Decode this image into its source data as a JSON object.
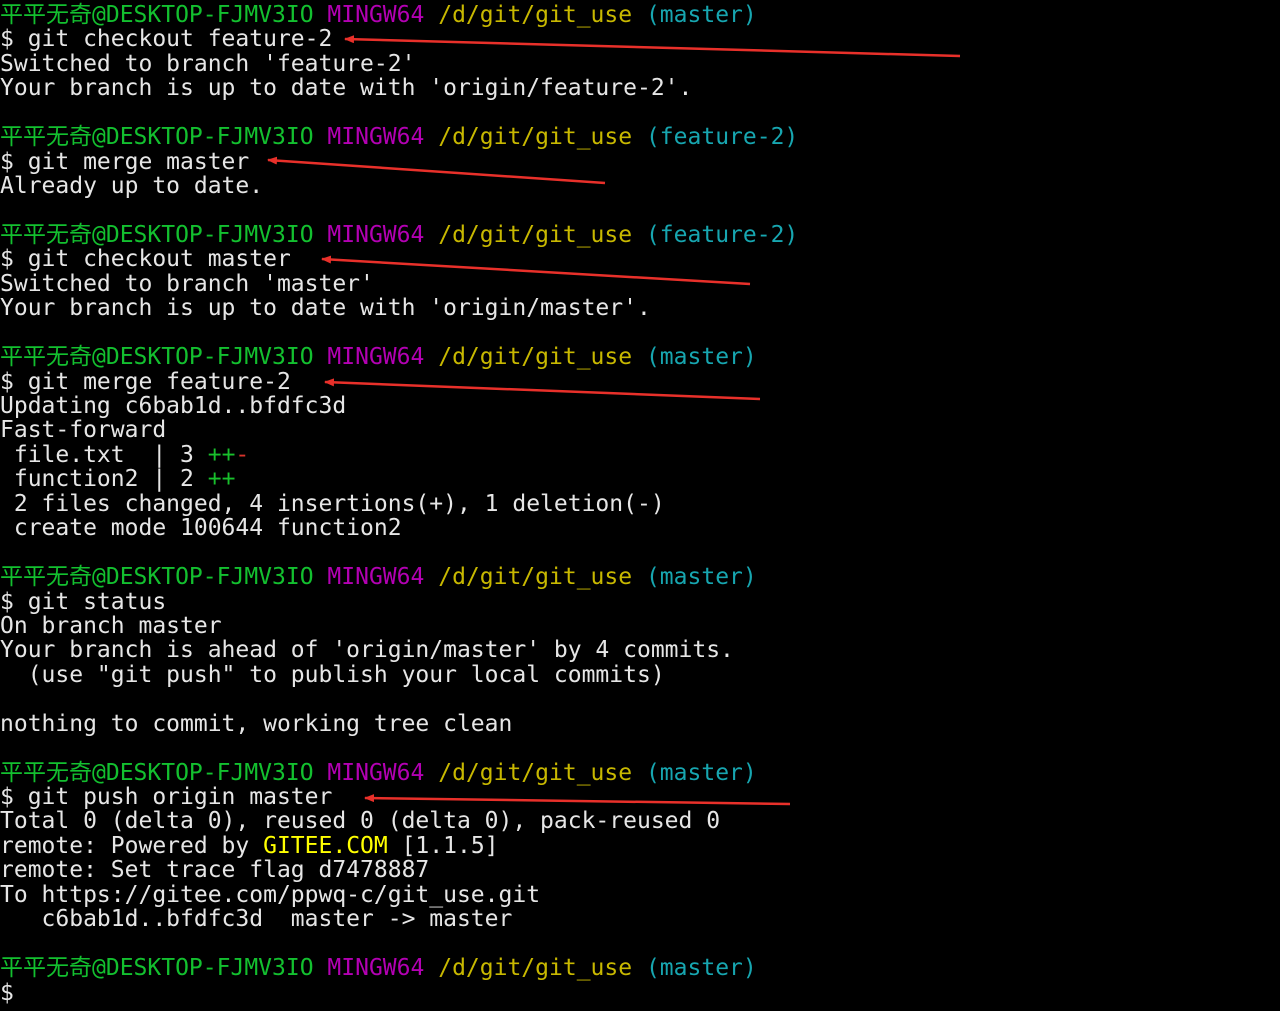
{
  "prompt": {
    "user": "平平无奇@DESKTOP-FJMV3IO",
    "host": "MINGW64",
    "path": "/d/git/git_use"
  },
  "lines": [
    {
      "k": "prompt",
      "branch": "(master)"
    },
    {
      "k": "cmd",
      "text": "$ git checkout feature-2"
    },
    {
      "k": "out",
      "text": "Switched to branch 'feature-2'"
    },
    {
      "k": "out",
      "text": "Your branch is up to date with 'origin/feature-2'."
    },
    {
      "k": "blank"
    },
    {
      "k": "prompt",
      "branch": "(feature-2)"
    },
    {
      "k": "cmd",
      "text": "$ git merge master"
    },
    {
      "k": "out",
      "text": "Already up to date."
    },
    {
      "k": "blank"
    },
    {
      "k": "prompt",
      "branch": "(feature-2)"
    },
    {
      "k": "cmd",
      "text": "$ git checkout master"
    },
    {
      "k": "out",
      "text": "Switched to branch 'master'"
    },
    {
      "k": "out",
      "text": "Your branch is up to date with 'origin/master'."
    },
    {
      "k": "blank"
    },
    {
      "k": "prompt",
      "branch": "(master)"
    },
    {
      "k": "cmd",
      "text": "$ git merge feature-2"
    },
    {
      "k": "out",
      "text": "Updating c6bab1d..bfdfc3d"
    },
    {
      "k": "out",
      "text": "Fast-forward"
    },
    {
      "k": "stat",
      "text": " file.txt  | 3 ",
      "plus": "++",
      "minus": "-"
    },
    {
      "k": "stat",
      "text": " function2 | 2 ",
      "plus": "++",
      "minus": ""
    },
    {
      "k": "out",
      "text": " 2 files changed, 4 insertions(+), 1 deletion(-)"
    },
    {
      "k": "out",
      "text": " create mode 100644 function2"
    },
    {
      "k": "blank"
    },
    {
      "k": "prompt",
      "branch": "(master)"
    },
    {
      "k": "cmd",
      "text": "$ git status"
    },
    {
      "k": "out",
      "text": "On branch master"
    },
    {
      "k": "out",
      "text": "Your branch is ahead of 'origin/master' by 4 commits."
    },
    {
      "k": "out",
      "text": "  (use \"git push\" to publish your local commits)"
    },
    {
      "k": "blank"
    },
    {
      "k": "out",
      "text": "nothing to commit, working tree clean"
    },
    {
      "k": "blank"
    },
    {
      "k": "prompt",
      "branch": "(master)"
    },
    {
      "k": "cmd",
      "text": "$ git push origin master"
    },
    {
      "k": "out",
      "text": "Total 0 (delta 0), reused 0 (delta 0), pack-reused 0"
    },
    {
      "k": "remote",
      "pre": "remote: Powered by ",
      "hl": "GITEE.COM",
      "post": " [1.1.5]"
    },
    {
      "k": "out",
      "text": "remote: Set trace flag d7478887"
    },
    {
      "k": "out",
      "text": "To https://gitee.com/ppwq-c/git_use.git"
    },
    {
      "k": "out",
      "text": "   c6bab1d..bfdfc3d  master -> master"
    },
    {
      "k": "blank"
    },
    {
      "k": "prompt",
      "branch": "(master)"
    },
    {
      "k": "cmd",
      "text": "$"
    }
  ],
  "annotations": {
    "arrow_color": "#e8302a",
    "arrows": [
      {
        "command": "git checkout feature-2"
      },
      {
        "command": "git merge master"
      },
      {
        "command": "git checkout master"
      },
      {
        "command": "git merge feature-2"
      },
      {
        "command": "git push origin master"
      }
    ]
  }
}
